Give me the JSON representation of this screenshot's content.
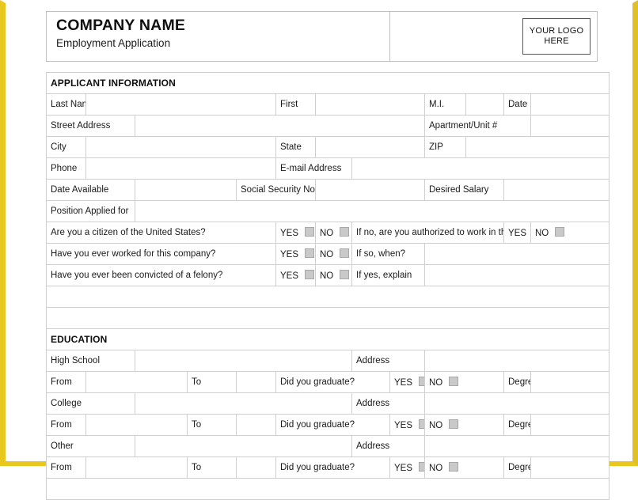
{
  "theme": {
    "page_border_color": "#e8c81e",
    "section_header_bg": "#dcdcdc",
    "cell_border_color": "#cfcfcf",
    "checkbox_fill": "#c9c9c9"
  },
  "header": {
    "company_name": "COMPANY NAME",
    "subtitle": "Employment Application",
    "logo_line1": "YOUR LOGO",
    "logo_line2": "HERE"
  },
  "sections": {
    "applicant": {
      "title": "APPLICANT INFORMATION",
      "labels": {
        "last_name": "Last Name",
        "first": "First",
        "mi": "M.I.",
        "date": "Date",
        "street_address": "Street Address",
        "apartment_unit": "Apartment/Unit #",
        "city": "City",
        "state": "State",
        "zip": "ZIP",
        "phone": "Phone",
        "email": "E-mail Address",
        "date_available": "Date Available",
        "ssn": "Social Security No.",
        "desired_salary": "Desired Salary",
        "position_applied_for": "Position Applied for"
      },
      "questions": [
        {
          "text": "Are you a citizen of the United States?",
          "yes": "YES",
          "no": "NO",
          "followup": "If no, are you authorized to work in the U.S.?",
          "followup_type": "yesno",
          "followup_yes": "YES",
          "followup_no": "NO"
        },
        {
          "text": "Have you ever worked for this company?",
          "yes": "YES",
          "no": "NO",
          "followup": "If so, when?",
          "followup_type": "text"
        },
        {
          "text": "Have you ever been convicted of a felony?",
          "yes": "YES",
          "no": "NO",
          "followup": "If yes, explain",
          "followup_type": "text"
        }
      ]
    },
    "education": {
      "title": "EDUCATION",
      "labels": {
        "address": "Address",
        "from": "From",
        "to": "To",
        "did_you_graduate": "Did you graduate?",
        "yes": "YES",
        "no": "NO",
        "degree": "Degree"
      },
      "entries": [
        {
          "name": "High School"
        },
        {
          "name": "College"
        },
        {
          "name": "Other"
        }
      ]
    }
  },
  "field_values": {
    "last_name": "",
    "first": "",
    "mi": "",
    "date": "",
    "street_address": "",
    "apartment_unit": "",
    "city": "",
    "state": "",
    "zip": "",
    "phone": "",
    "email": "",
    "date_available": "",
    "ssn": "",
    "desired_salary": "",
    "position_applied_for": ""
  }
}
